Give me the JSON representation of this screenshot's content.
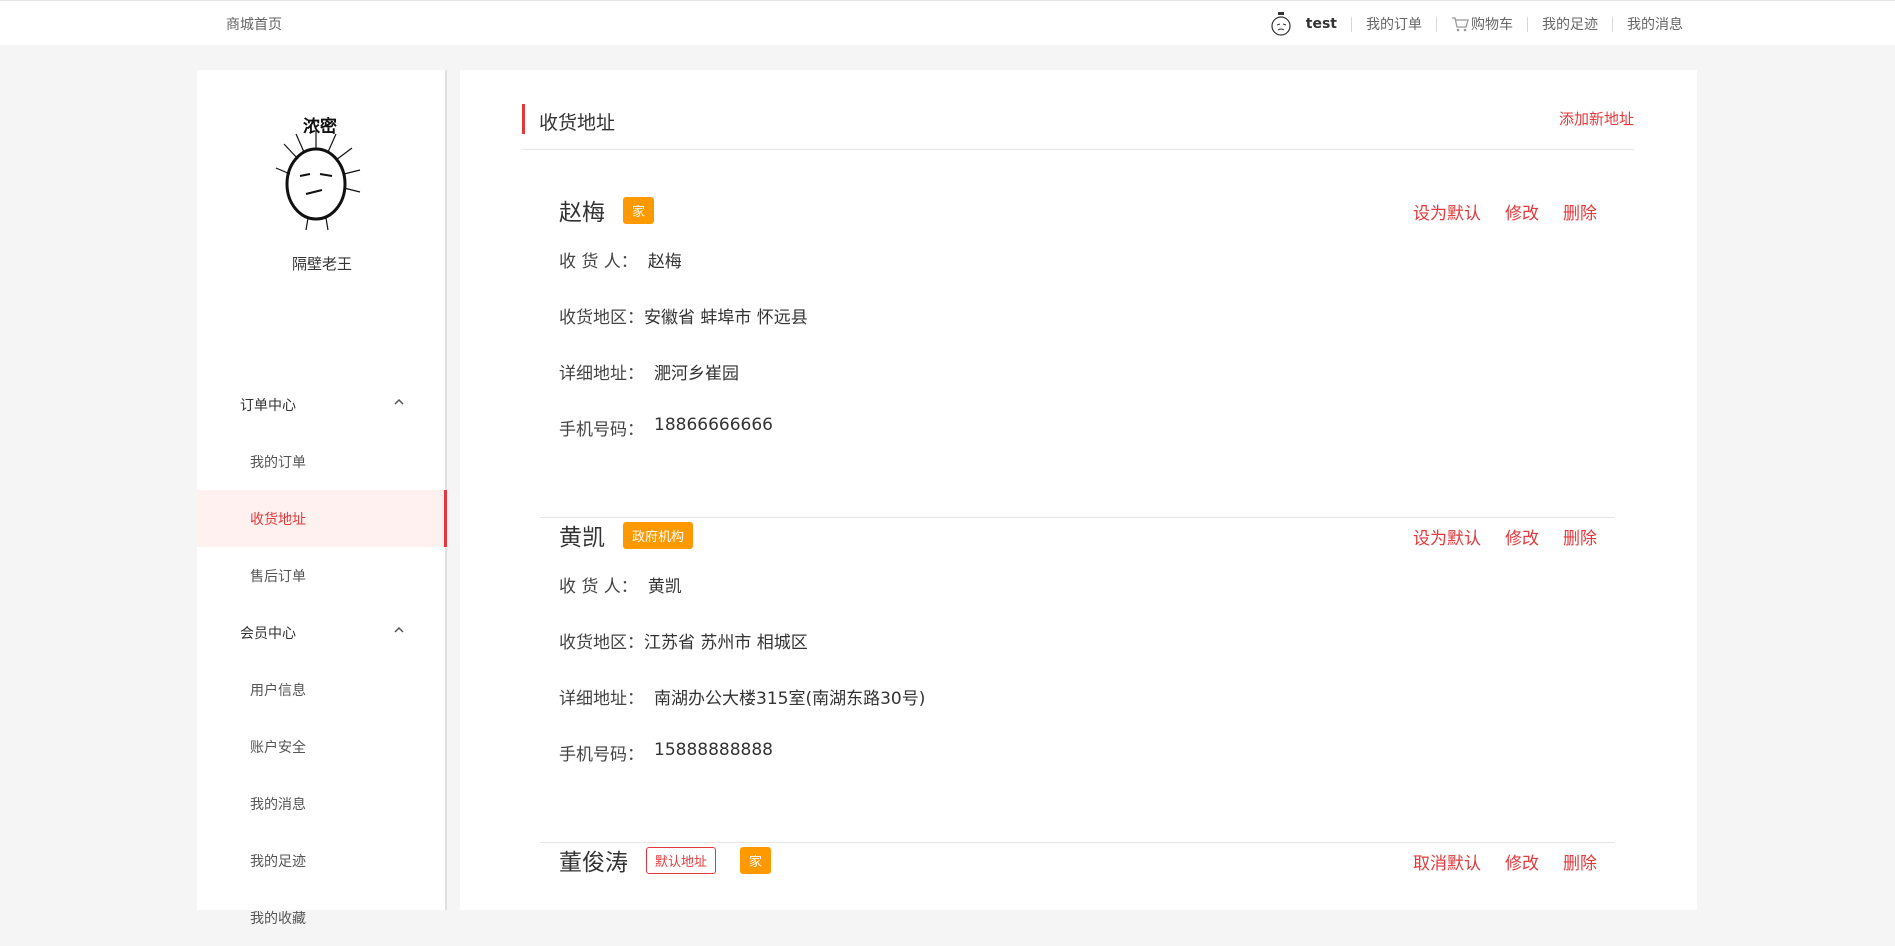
{
  "topbar": {
    "home": "商城首页",
    "username": "test",
    "links": [
      "我的订单",
      "购物车",
      "我的足迹",
      "我的消息"
    ]
  },
  "sidebar": {
    "profile_name": "隔壁老王",
    "avatar_caption": "浓密",
    "groups": [
      {
        "label": "订单中心",
        "items": [
          "我的订单",
          "收货地址",
          "售后订单"
        ]
      },
      {
        "label": "会员中心",
        "items": [
          "用户信息",
          "账户安全",
          "我的消息",
          "我的足迹",
          "我的收藏"
        ]
      }
    ],
    "active_item": "收货地址"
  },
  "main": {
    "title": "收货地址",
    "add_new": "添加新地址",
    "labels": {
      "receiver": "收 货 人：",
      "region": "收货地区：",
      "detail": "详细地址：",
      "phone": "手机号码："
    },
    "addresses": [
      {
        "name": "赵梅",
        "tags": [
          "家"
        ],
        "receiver": "赵梅",
        "region": "安徽省 蚌埠市 怀远县",
        "detail": "淝河乡崔园",
        "phone": "18866666666",
        "actions": [
          "设为默认",
          "修改",
          "删除"
        ]
      },
      {
        "name": "黄凯",
        "tags": [
          "政府机构"
        ],
        "receiver": "黄凯",
        "region": "江苏省 苏州市 相城区",
        "detail": "南湖办公大楼315室(南湖东路30号)",
        "phone": "15888888888",
        "actions": [
          "设为默认",
          "修改",
          "删除"
        ]
      },
      {
        "name": "董俊涛",
        "default_tag": "默认地址",
        "tags": [
          "家"
        ],
        "actions": [
          "取消默认",
          "修改",
          "删除"
        ]
      }
    ]
  },
  "colors": {
    "accent": "#e4393c",
    "tag_orange": "#ff9900",
    "active_bg": "#fff1ef"
  }
}
